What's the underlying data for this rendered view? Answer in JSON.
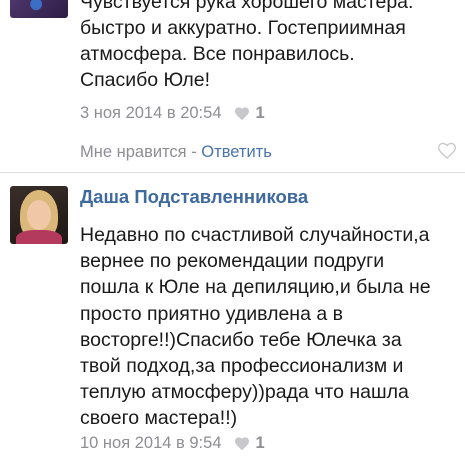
{
  "comments": [
    {
      "text": "Чувствуется рука хорошего мастера:\nбыстро и аккуратно. Гостеприимная\nатмосфера. Все понравилось.\nСпасибо Юле!",
      "date": "3 ноя 2014 в 20:54",
      "likes": "1",
      "actions": {
        "like_label": "Мне нравится",
        "separator": " - ",
        "reply_label": "Ответить"
      }
    },
    {
      "author": "Даша Подставленникова",
      "text": "Недавно по счастливой случайности,а\nвернее по рекомендации подруги\nпошла к Юле на депиляцию,и была не\nпросто приятно удивлена а в\nвосторге!!)Спасибо тебе Юлечка за\nтвой подход,за профессионализм и\nтеплую атмосферу))рада что нашла\nсвоего мастера!!)",
      "date": "10 ноя 2014 в 9:54",
      "likes": "1"
    }
  ],
  "colors": {
    "link": "#4a74a8",
    "author": "#3f6a9e",
    "meta": "#8e8e93",
    "divider": "#dcdcdc"
  },
  "icons": {
    "like_count": "heart-icon",
    "like_action": "heart-outline-icon"
  }
}
